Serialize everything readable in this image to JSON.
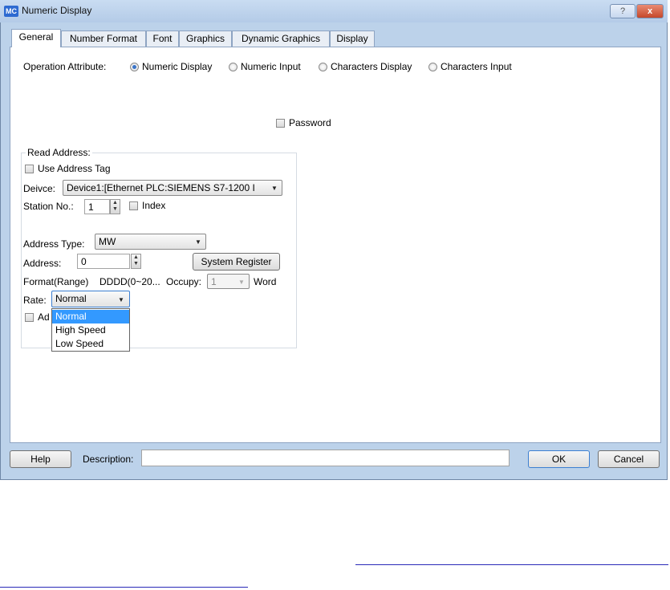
{
  "window": {
    "app_icon_text": "MC",
    "title": "Numeric Display",
    "help_caption": "?",
    "close_caption": "x"
  },
  "tabs": [
    {
      "label": "General",
      "active": true
    },
    {
      "label": "Number Format"
    },
    {
      "label": "Font"
    },
    {
      "label": "Graphics"
    },
    {
      "label": "Dynamic Graphics"
    },
    {
      "label": "Display"
    }
  ],
  "operation": {
    "label": "Operation Attribute:",
    "options": [
      {
        "label": "Numeric Display",
        "selected": true
      },
      {
        "label": "Numeric Input"
      },
      {
        "label": "Characters Display"
      },
      {
        "label": "Characters Input"
      }
    ]
  },
  "password": {
    "label": "Password",
    "checked": false
  },
  "read_address": {
    "group_label": "Read Address:",
    "use_tag_label": "Use Address Tag",
    "device_label": "Deivce:",
    "device_value": "Device1:[Ethernet PLC:SIEMENS S7-1200 I",
    "station_label": "Station No.:",
    "station_value": "1",
    "index_label": "Index",
    "address_type_label": "Address Type:",
    "address_type_value": "MW",
    "address_label": "Address:",
    "address_value": "0",
    "system_register_label": "System Register",
    "format_label": "Format(Range)",
    "format_value": "DDDD(0~20...",
    "occupy_label": "Occupy:",
    "occupy_value": "1",
    "word_label": "Word",
    "rate_label": "Rate:",
    "rate_value": "Normal",
    "rate_options": [
      "Normal",
      "High Speed",
      "Low Speed"
    ],
    "partial_checkbox_label": "Ad"
  },
  "footer": {
    "help_label": "Help",
    "description_label": "Description:",
    "description_value": "",
    "ok_label": "OK",
    "cancel_label": "Cancel"
  },
  "colors": {
    "window_frame": "#bcd2ea",
    "selection": "#3399ff",
    "link": "#2a2ab8"
  }
}
